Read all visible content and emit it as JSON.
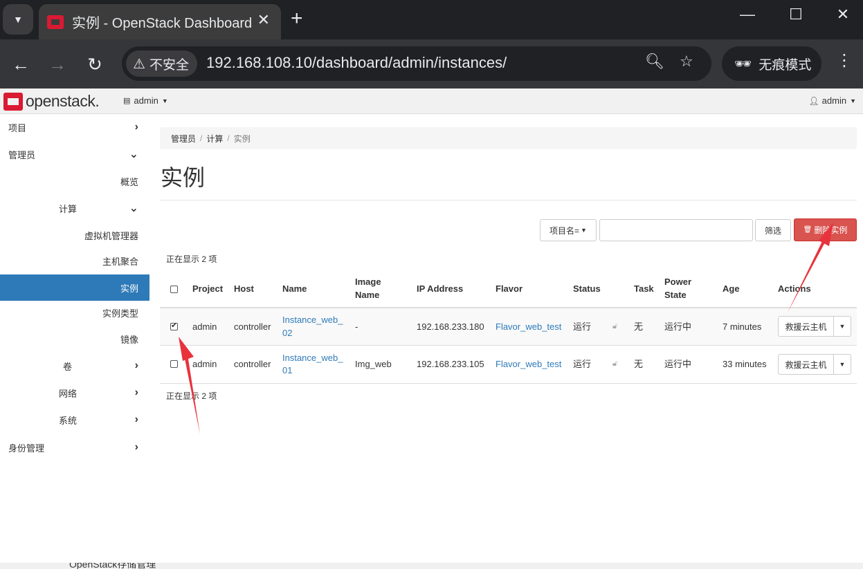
{
  "browser": {
    "tab_title": "实例 - OpenStack Dashboard",
    "tab_close": "✕",
    "new_tab": "+",
    "security_label": "不安全",
    "url": "192.168.108.10/dashboard/admin/instances/",
    "incognito_label": "无痕模式"
  },
  "header": {
    "logo_text": "openstack.",
    "project": "admin",
    "user": "admin"
  },
  "sidebar": {
    "items": [
      {
        "label": "项目"
      },
      {
        "label": "管理员"
      },
      {
        "label": "概览"
      },
      {
        "label": "计算"
      },
      {
        "label": "虚拟机管理器"
      },
      {
        "label": "主机聚合"
      },
      {
        "label": "实例"
      },
      {
        "label": "实例类型"
      },
      {
        "label": "镜像"
      },
      {
        "label": "卷"
      },
      {
        "label": "网络"
      },
      {
        "label": "系统"
      },
      {
        "label": "身份管理"
      }
    ]
  },
  "breadcrumb": [
    "管理员",
    "计算",
    "实例"
  ],
  "page_title": "实例",
  "filter": {
    "select_label": "项目名=",
    "input_value": "",
    "filter_button": "筛选",
    "delete_button": "删除实例"
  },
  "count_text": "正在显示 2 项",
  "table": {
    "headers": [
      "Project",
      "Host",
      "Name",
      "Image Name",
      "IP Address",
      "Flavor",
      "Status",
      "Task",
      "Power State",
      "Age",
      "Actions"
    ],
    "rows": [
      {
        "checked": true,
        "project": "admin",
        "host": "controller",
        "name_line1": "Instance_web_",
        "name_line2": "02",
        "image": "-",
        "ip": "192.168.233.180",
        "flavor": "Flavor_web_test",
        "status": "运行",
        "task": "无",
        "power": "运行中",
        "age": "7 minutes",
        "action": "救援云主机"
      },
      {
        "checked": false,
        "project": "admin",
        "host": "controller",
        "name_line1": "Instance_web_",
        "name_line2": "01",
        "image": "Img_web",
        "ip": "192.168.233.105",
        "flavor": "Flavor_web_test",
        "status": "运行",
        "task": "无",
        "power": "运行中",
        "age": "33 minutes",
        "action": "救援云主机"
      }
    ]
  },
  "bottom_text": "OpenStack存储管理",
  "colors": {
    "accent": "#2e7ab8",
    "danger": "#d9534f",
    "annotation_arrow": "#e8323c"
  }
}
